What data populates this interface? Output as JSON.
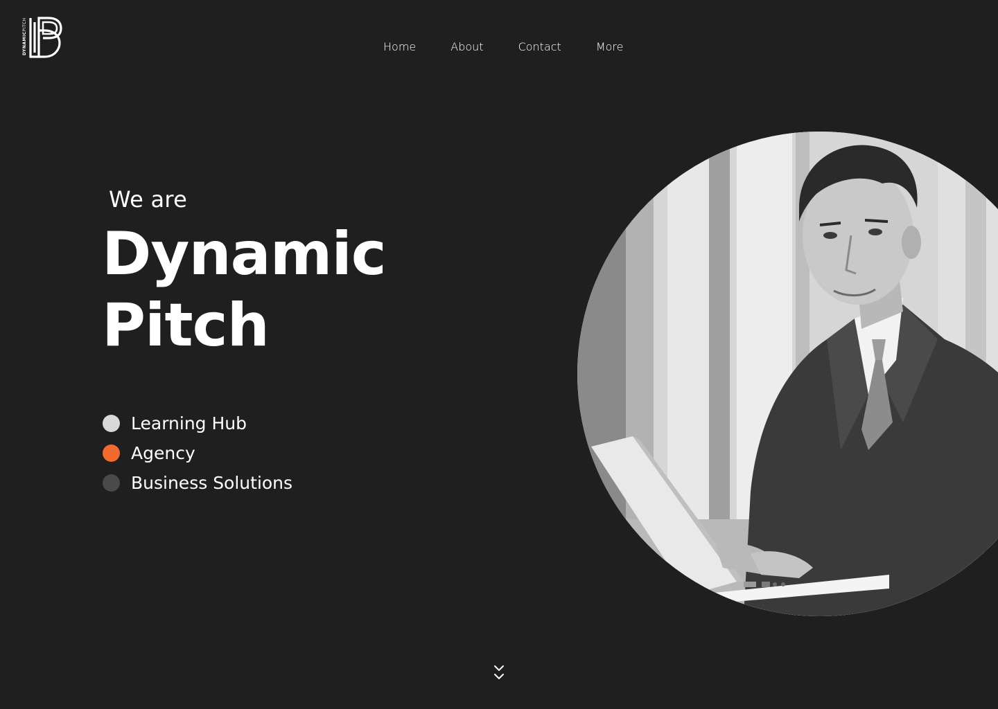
{
  "brand": {
    "logo_letters": "DP",
    "logo_vertical_bold": "DYNAMIC",
    "logo_vertical_light": "PITCH"
  },
  "nav": {
    "items": [
      {
        "label": "Home"
      },
      {
        "label": "About"
      },
      {
        "label": "Contact"
      },
      {
        "label": "More"
      }
    ]
  },
  "hero": {
    "intro": "We are",
    "title_line1": "Dynamic",
    "title_line2": "Pitch",
    "image_alt": "smiling businessman in suit holding a laptop"
  },
  "services": [
    {
      "label": "Learning Hub",
      "color": "#d9d9d9"
    },
    {
      "label": "Agency",
      "color": "#f26a2e"
    },
    {
      "label": "Business Solutions",
      "color": "#4a4a4a"
    }
  ],
  "colors": {
    "background": "#1f1f1f",
    "text": "#ffffff",
    "accent": "#f26a2e"
  },
  "icons": {
    "scroll": "double-chevron-down-icon"
  }
}
